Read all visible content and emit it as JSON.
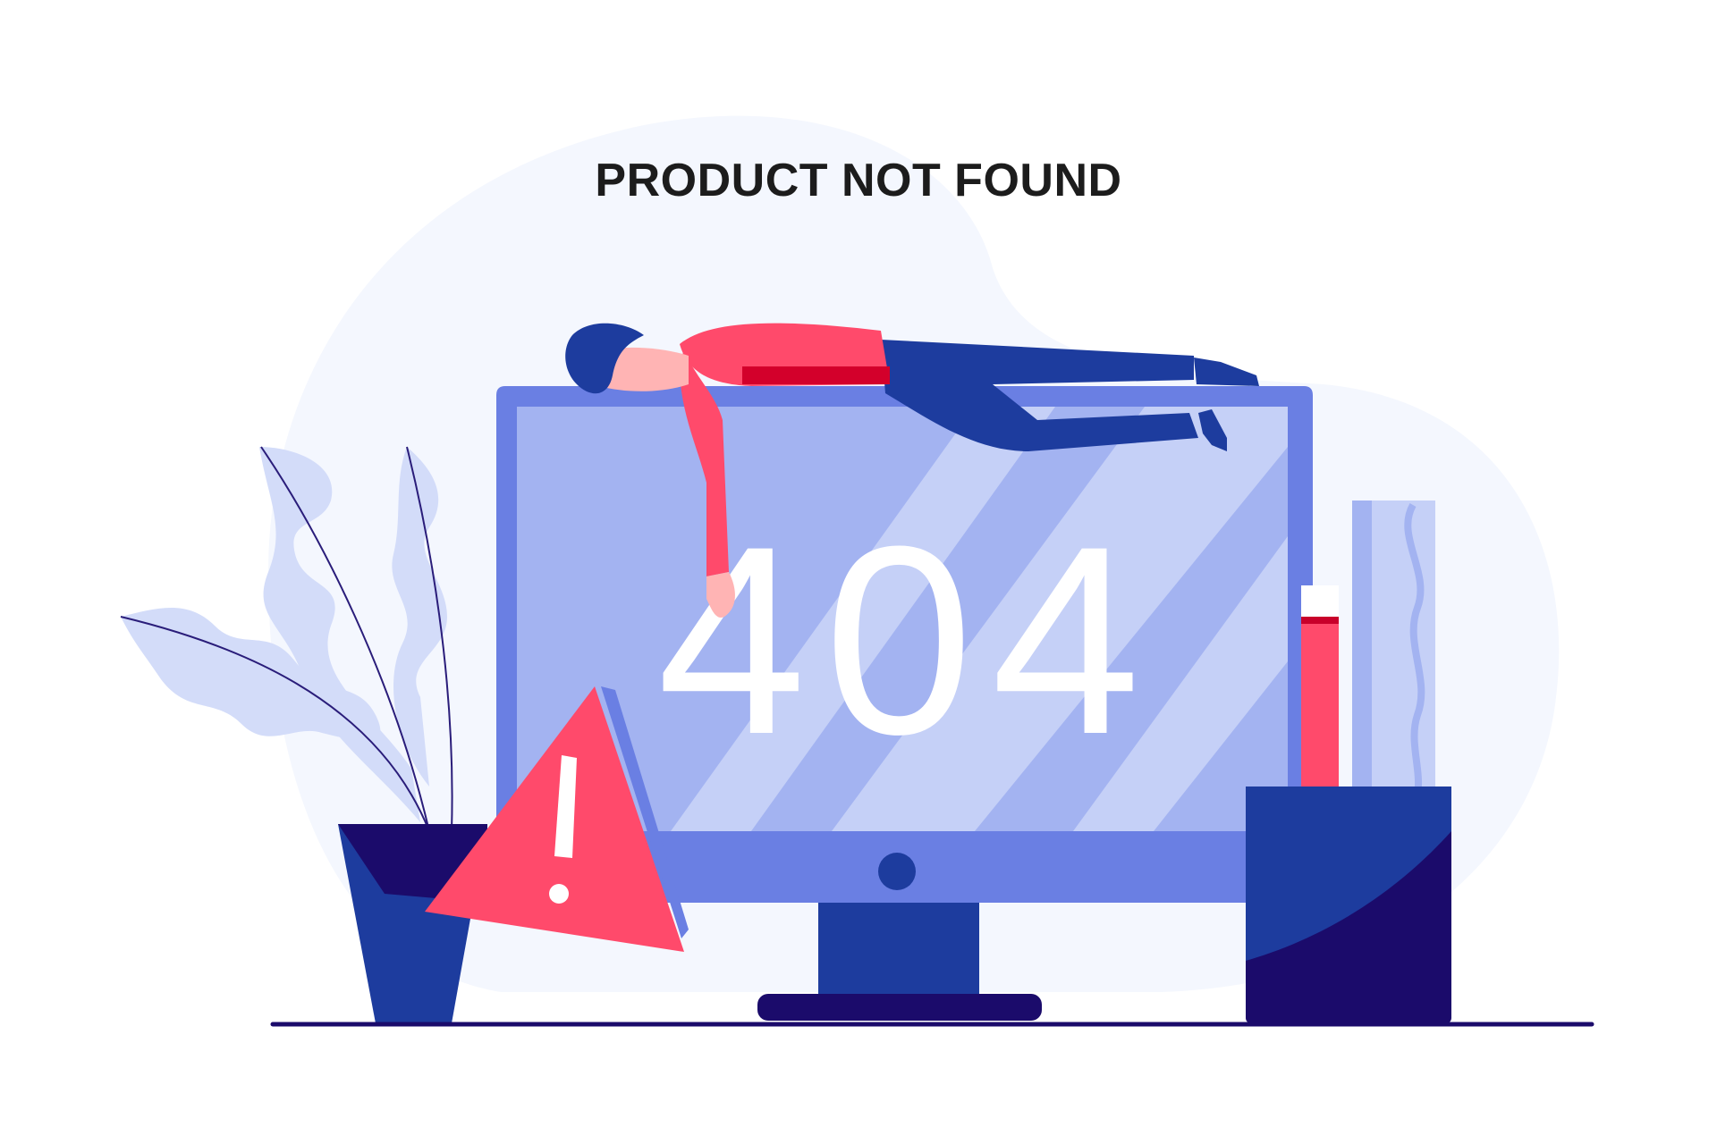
{
  "page": {
    "title": "PRODUCT NOT FOUND",
    "error_code": "404"
  },
  "icons": {
    "warning": "warning-triangle-icon"
  },
  "colors": {
    "background_blob": "#f4f7fe",
    "monitor_frame": "#6a7fe3",
    "monitor_screen": "#a3b3f1",
    "screen_reflection": "#c5d0f7",
    "stand": "#1d3c9e",
    "base": "#1b0b6b",
    "person_shirt": "#ff4a6b",
    "person_pants": "#1d3c9e",
    "warning_red": "#ff4a6b",
    "plant_leaves": "#d3dcf9",
    "ground_line": "#1b0b6b"
  }
}
